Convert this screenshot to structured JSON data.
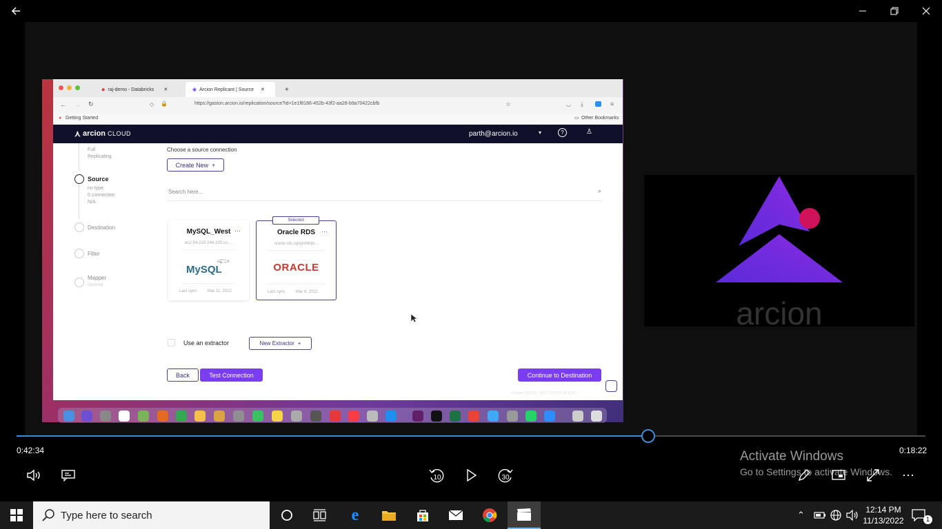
{
  "player": {
    "elapsed": "0:42:34",
    "remaining": "0:18:22",
    "progress_fraction": 0.695,
    "skip_back_label": "10",
    "skip_forward_label": "30",
    "watermark_title": "Activate Windows",
    "watermark_sub": "Go to Settings to activate Windows."
  },
  "recording": {
    "browser": {
      "tabs": [
        {
          "label": "raj-demo - Databricks"
        },
        {
          "label": "Arcion Replicant | Source"
        }
      ],
      "url": "https://gaston.arcion.io/replication/source?id=1e1f8186-452b-43f2-aa28-b9a70422cbfb",
      "bookmark_left": "Getting Started",
      "bookmark_right": "Other Bookmarks"
    },
    "app": {
      "brand": "arcion",
      "brand_suffix": "CLOUD",
      "user": "parth@arcion.io",
      "steps": [
        {
          "label": "Source",
          "lines": [
            "no type",
            "0 connection",
            "N/A"
          ]
        },
        {
          "label": "Destination"
        },
        {
          "label": "Filter"
        },
        {
          "label": "Mapper",
          "sub": "Optional"
        }
      ],
      "step_prev_lines": [
        "Full",
        "Replicating"
      ],
      "heading": "Choose a source connection",
      "create_new": "Create New",
      "search_placeholder": "Search here...",
      "cards": [
        {
          "name": "MySQL_West",
          "host": "ec2-54-215-246-205.us-...",
          "logo": "MySQL",
          "last_sync": "Last sync",
          "date": "Mar 11, 2022",
          "selected": false
        },
        {
          "name": "Oracle RDS",
          "host": "oracle-rds.cgvylvhilqtz...",
          "logo": "ORACLE",
          "last_sync": "Last sync",
          "date": "Mar 9, 2022",
          "selected": true,
          "badge": "Selected"
        }
      ],
      "extractor_label": "Use an extractor",
      "new_extractor": "New Extractor",
      "back": "Back",
      "test_connection": "Test Connection",
      "continue": "Continue to Destination",
      "footer_text": "Scheme 2022.11 · GCK 2.4.2022 09:11:01"
    },
    "side_logo_text": "arcion"
  },
  "taskbar": {
    "search_placeholder": "Type here to search",
    "time": "12:14 PM",
    "date": "11/13/2022",
    "notification_count": "1"
  },
  "colors": {
    "accent": "#3c8dd8",
    "app_header": "#10102a",
    "app_button": "#7a3df0",
    "oracle_red": "#c7372f"
  }
}
